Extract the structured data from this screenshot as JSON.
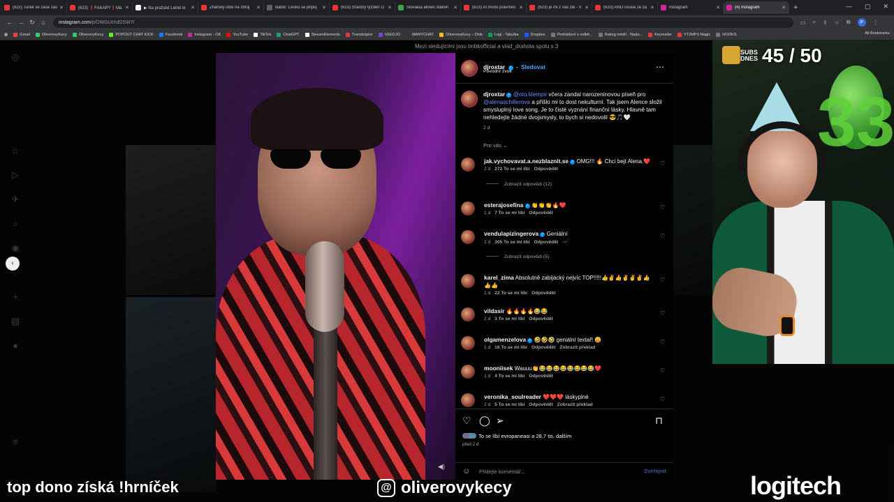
{
  "browser": {
    "tabs": [
      {
        "label": "(622) Turek se zase zas",
        "color": "#e53935"
      },
      {
        "label": "(623) ❗FAKAPY❗Má",
        "color": "#e53935"
      },
      {
        "label": "▶ Na pražské Letné le",
        "color": "#ffffff"
      },
      {
        "label": "Žhářský útok na zbroj",
        "color": "#e53935"
      },
      {
        "label": "Babiš: Česko se připoj",
        "color": "#5f6368"
      },
      {
        "label": "(623) Šťastný týždeň O",
        "color": "#e53935"
      },
      {
        "label": "Slovakia allows station",
        "color": "#43a047"
      },
      {
        "label": "(623) AI místo právníků",
        "color": "#e53935"
      },
      {
        "label": "(623) je mi z vás zle - V",
        "color": "#e53935"
      },
      {
        "label": "(623) ANO couvá ze za",
        "color": "#e53935"
      },
      {
        "label": "Instagram",
        "color": "#d6249f"
      },
      {
        "label": "(4) Instagram",
        "color": "#d6249f"
      }
    ],
    "url_host": "instagram.com",
    "url_path": "/p/DWGUtXdDSW7/",
    "bookmarks": [
      {
        "label": "Gmail",
        "color": "#ea4335"
      },
      {
        "label": "OliverovyKecy",
        "color": "#2ecc71"
      },
      {
        "label": "OliverovyKecy",
        "color": "#2ecc71"
      },
      {
        "label": "POPOUT CHAT KICK",
        "color": "#53fc18"
      },
      {
        "label": "Facebook",
        "color": "#1877f2"
      },
      {
        "label": "Instagram - OK",
        "color": "#d6249f"
      },
      {
        "label": "YouTube",
        "color": "#ff0000"
      },
      {
        "label": "TikTok",
        "color": "#ffffff"
      },
      {
        "label": "ChatGPT",
        "color": "#10a37f"
      },
      {
        "label": "StreamElements",
        "color": "#ffffff"
      },
      {
        "label": "Transkriptor",
        "color": "#e53935"
      },
      {
        "label": "VEEDJO",
        "color": "#7b3fe4"
      },
      {
        "label": "MANYCHAT",
        "color": "#333333"
      },
      {
        "label": "OliverovyKecy – Disk",
        "color": "#fbbc04"
      },
      {
        "label": "Logi - Tabulka",
        "color": "#0f9d58"
      },
      {
        "label": "Dropbox",
        "color": "#0061ff"
      },
      {
        "label": "Prohlášení o volbě...",
        "color": "#777777"
      },
      {
        "label": "Rating médií - Nada...",
        "color": "#777777"
      },
      {
        "label": "Keymailer",
        "color": "#e53935"
      },
      {
        "label": "YT2MP3 Magic",
        "color": "#e53935"
      },
      {
        "label": "HOOKS",
        "color": "#777777"
      }
    ],
    "all_bookmarks": "All Bookmarks"
  },
  "instagram": {
    "top_banner": "Mezi sledujícími jsou tmbkofficial a vlad_drahota spolu s 3",
    "post": {
      "author": "djroxtar",
      "follow_label": "Sledovat",
      "audio": "Původní zvuk",
      "caption_author": "djroxtar",
      "caption_mention1": "@oto.klempir",
      "caption_part1": " včera zandal narozeninovou píseň pro ",
      "caption_mention2": "@alenaschillerova",
      "caption_part2": " a přišlo mi to dost nekulturní. Tak jsem Alence složil smysluplný love song. Je to čisté vyznání finanční lásky. Hlavně tam nehledejte žádné dvojsmysly, to bych si nedovolil 😎🎵🤍",
      "caption_age": "2 d",
      "for_you": "Pro vás ⌄",
      "likes_text": "To se líbí evropaneasi a 28,7 tis. dalším",
      "posted": "před 2 d",
      "comment_placeholder": "Přidejte komentář...",
      "publish_label": "Zveřejnit"
    },
    "comments": [
      {
        "user": "jak.vychovavat.a.nezblaznit.se",
        "verified": true,
        "text": "OMG!!! 🔥 Chci bejt Alena.❤️",
        "age": "2 d",
        "likes": "272 To se mi líbí",
        "reply": "Odpovědět",
        "extra": "",
        "replies": "Zobrazit odpovědi (12)"
      },
      {
        "user": "esterajosefina",
        "verified": true,
        "text": "👏👏👏🔥❤️",
        "age": "1 d",
        "likes": "7 To se mi líbí",
        "reply": "Odpovědět",
        "extra": "",
        "replies": ""
      },
      {
        "user": "vendulapizingerova",
        "verified": true,
        "text": "Geniální",
        "age": "2 d",
        "likes": "305 To se mi líbí",
        "reply": "Odpovědět",
        "extra": "⋯",
        "replies": "Zobrazit odpovědi (5)"
      },
      {
        "user": "karel_zima",
        "verified": false,
        "text": "Absolutně zabijácký nejvíc TOP!!!!!👍✌️👍✌️✌️✌️👍👍👍",
        "age": "1 d",
        "likes": "22 To se mi líbí",
        "reply": "Odpovědět",
        "extra": "",
        "replies": ""
      },
      {
        "user": "vildasir",
        "verified": false,
        "text": "🔥🔥🔥🔥😂😂",
        "age": "2 d",
        "likes": "3 To se mi líbí",
        "reply": "Odpovědět",
        "extra": "",
        "replies": ""
      },
      {
        "user": "olgamenzelova",
        "verified": true,
        "text": "🤣🤣🤣 geniální textař! 😀",
        "age": "1 d",
        "likes": "16 To se mi líbí",
        "reply": "Odpovědět",
        "extra": "Zobrazit překlad",
        "replies": ""
      },
      {
        "user": "mooniisek",
        "verified": false,
        "text": "Wauuu👏😂😂😂😂😂😂😂😂❤️",
        "age": "1 d",
        "likes": "4 To se mi líbí",
        "reply": "Odpovědět",
        "extra": "",
        "replies": ""
      },
      {
        "user": "veronika_soulreader",
        "verified": false,
        "text": "❤️❤️❤️ láskyplné",
        "age": "2 d",
        "likes": "5 To se mi líbí",
        "reply": "Odpovědět",
        "extra": "Zobrazit překlad",
        "replies": ""
      }
    ]
  },
  "stream": {
    "subs_label_1": "SUBS",
    "subs_label_2": "DNES",
    "subs_count": "45 / 50",
    "balloon_number": "33",
    "overlay_left": "top dono získá !hrníček",
    "overlay_handle": "oliverovykecy",
    "overlay_brand": "logitech"
  },
  "colors": {
    "accent": "#0095f6",
    "mention": "#6f8cff",
    "page_bg": "#0b0b0c"
  }
}
